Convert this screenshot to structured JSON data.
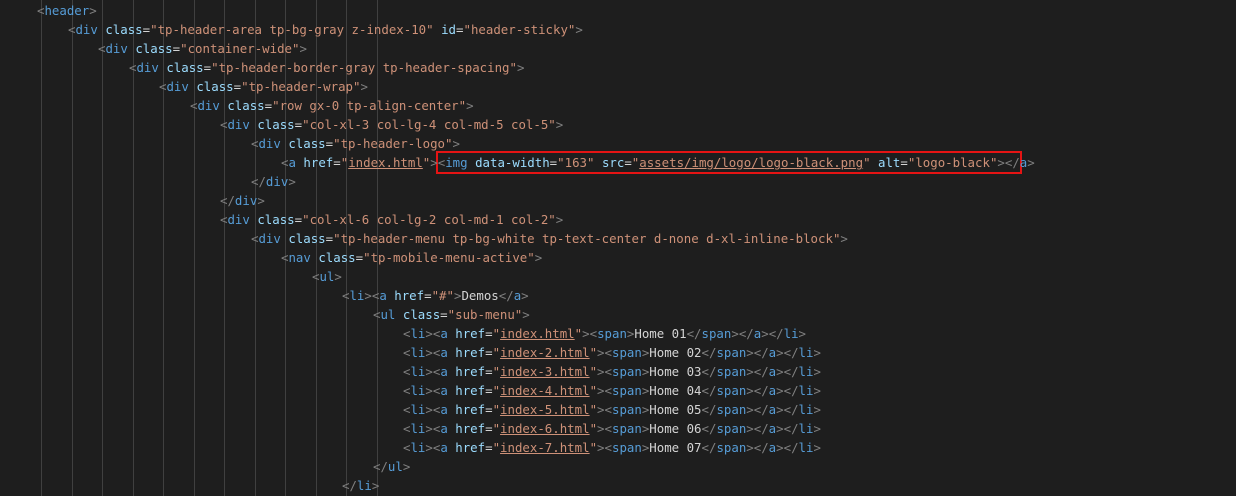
{
  "lines": [
    {
      "indent": 1,
      "kind": "open",
      "tag": "header",
      "attrs": []
    },
    {
      "indent": 2,
      "kind": "open",
      "tag": "div",
      "attrs": [
        {
          "name": "class",
          "value": "tp-header-area tp-bg-gray z-index-10"
        },
        {
          "name": "id",
          "value": "header-sticky"
        }
      ]
    },
    {
      "indent": 3,
      "kind": "open",
      "tag": "div",
      "attrs": [
        {
          "name": "class",
          "value": "container-wide"
        }
      ]
    },
    {
      "indent": 4,
      "kind": "open",
      "tag": "div",
      "attrs": [
        {
          "name": "class",
          "value": "tp-header-border-gray tp-header-spacing"
        }
      ]
    },
    {
      "indent": 5,
      "kind": "open",
      "tag": "div",
      "attrs": [
        {
          "name": "class",
          "value": "tp-header-wrap"
        }
      ]
    },
    {
      "indent": 6,
      "kind": "open",
      "tag": "div",
      "attrs": [
        {
          "name": "class",
          "value": "row gx-0 tp-align-center"
        }
      ]
    },
    {
      "indent": 7,
      "kind": "open",
      "tag": "div",
      "attrs": [
        {
          "name": "class",
          "value": "col-xl-3 col-lg-4 col-md-5 col-5"
        }
      ]
    },
    {
      "indent": 8,
      "kind": "open",
      "tag": "div",
      "attrs": [
        {
          "name": "class",
          "value": "tp-header-logo"
        }
      ]
    },
    {
      "indent": 9,
      "kind": "logo-line",
      "tag": "a",
      "href": "index.html",
      "img_attrs": [
        {
          "name": "data-width",
          "value": "163"
        },
        {
          "name": "src",
          "value": "assets/img/logo/logo-black.png",
          "link": true
        },
        {
          "name": "alt",
          "value": "logo-black"
        }
      ]
    },
    {
      "indent": 8,
      "kind": "close",
      "tag": "div"
    },
    {
      "indent": 7,
      "kind": "close",
      "tag": "div"
    },
    {
      "indent": 7,
      "kind": "open",
      "tag": "div",
      "attrs": [
        {
          "name": "class",
          "value": "col-xl-6 col-lg-2 col-md-1 col-2"
        }
      ]
    },
    {
      "indent": 8,
      "kind": "open",
      "tag": "div",
      "attrs": [
        {
          "name": "class",
          "value": "tp-header-menu tp-bg-white tp-text-center d-none d-xl-inline-block"
        }
      ]
    },
    {
      "indent": 9,
      "kind": "open",
      "tag": "nav",
      "attrs": [
        {
          "name": "class",
          "value": "tp-mobile-menu-active"
        }
      ]
    },
    {
      "indent": 10,
      "kind": "open",
      "tag": "ul",
      "attrs": []
    },
    {
      "indent": 11,
      "kind": "li-link",
      "href": "#",
      "text": "Demos",
      "span": false,
      "close_li": false
    },
    {
      "indent": 12,
      "kind": "open",
      "tag": "ul",
      "attrs": [
        {
          "name": "class",
          "value": "sub-menu"
        }
      ]
    },
    {
      "indent": 13,
      "kind": "li-link",
      "href": "index.html",
      "text": "Home 01",
      "span": true,
      "close_li": true
    },
    {
      "indent": 13,
      "kind": "li-link",
      "href": "index-2.html",
      "text": "Home 02",
      "span": true,
      "close_li": true
    },
    {
      "indent": 13,
      "kind": "li-link",
      "href": "index-3.html",
      "text": "Home 03",
      "span": true,
      "close_li": true
    },
    {
      "indent": 13,
      "kind": "li-link",
      "href": "index-4.html",
      "text": "Home 04",
      "span": true,
      "close_li": true
    },
    {
      "indent": 13,
      "kind": "li-link",
      "href": "index-5.html",
      "text": "Home 05",
      "span": true,
      "close_li": true
    },
    {
      "indent": 13,
      "kind": "li-link",
      "href": "index-6.html",
      "text": "Home 06",
      "span": true,
      "close_li": true
    },
    {
      "indent": 13,
      "kind": "li-link",
      "href": "index-7.html",
      "text": "Home 07",
      "span": true,
      "close_li": true
    },
    {
      "indent": 12,
      "kind": "close",
      "tag": "ul"
    },
    {
      "indent": 11,
      "kind": "close",
      "tag": "li"
    }
  ],
  "highlighted_line": 8,
  "colors": {
    "background": "#1e1e1e",
    "tag": "#569cd6",
    "attribute": "#9cdcfe",
    "string": "#ce9178",
    "bracket": "#808080",
    "text": "#d4d4d4",
    "highlight_border": "#e51414",
    "indent_guide": "#404040"
  }
}
